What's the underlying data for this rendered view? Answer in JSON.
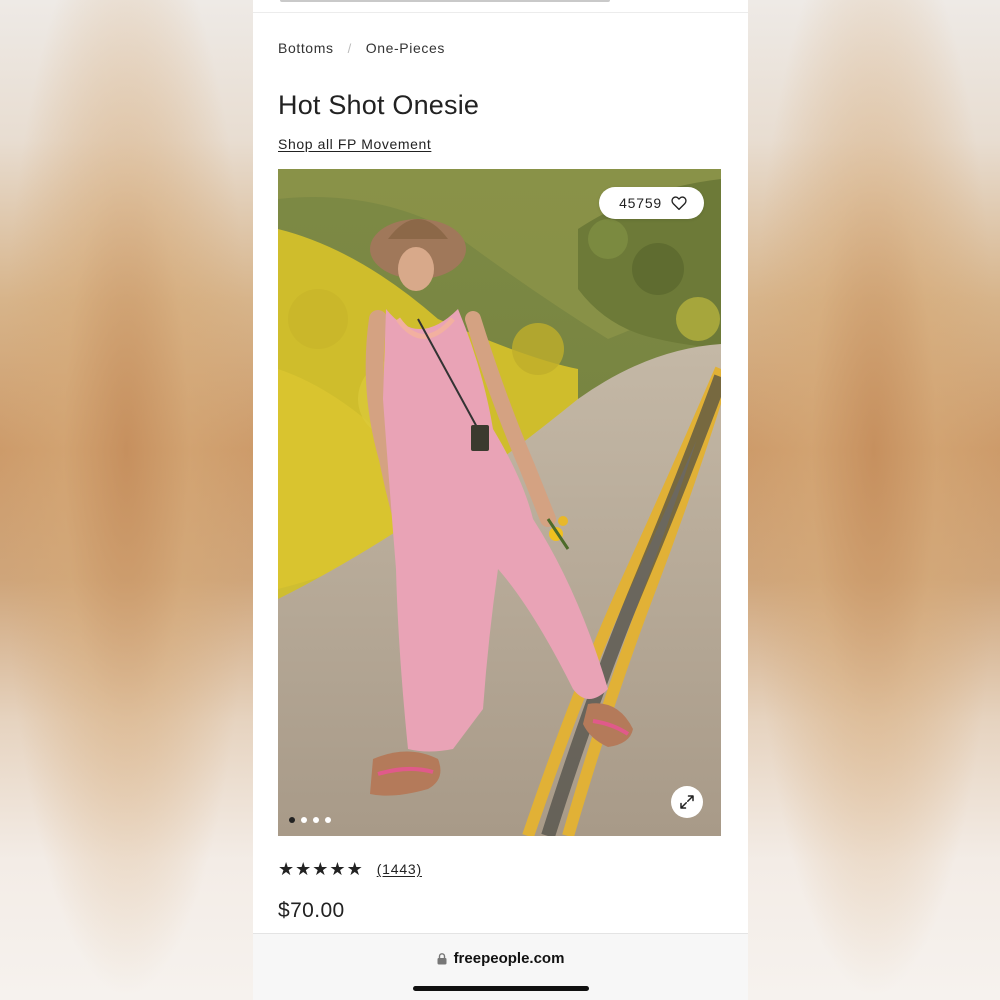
{
  "breadcrumb": {
    "items": [
      "Bottoms",
      "One-Pieces"
    ],
    "separator": "/"
  },
  "product": {
    "title": "Hot Shot Onesie",
    "brand_link": "Shop all FP Movement",
    "favorites_count": "45759",
    "rating_stars": 5,
    "review_count": "(1443)",
    "price": "$70.00"
  },
  "gallery": {
    "slide_count": 4,
    "active_slide": 1,
    "icons": {
      "favorite": "heart-icon",
      "expand": "expand-icon"
    }
  },
  "browser": {
    "url": "freepeople.com",
    "lock_icon": "lock-icon"
  },
  "colors": {
    "text": "#222222",
    "jumpsuit_pink": "#e9a3b6",
    "road_line_yellow": "#e1b136",
    "flowers_yellow": "#d9c22a"
  }
}
